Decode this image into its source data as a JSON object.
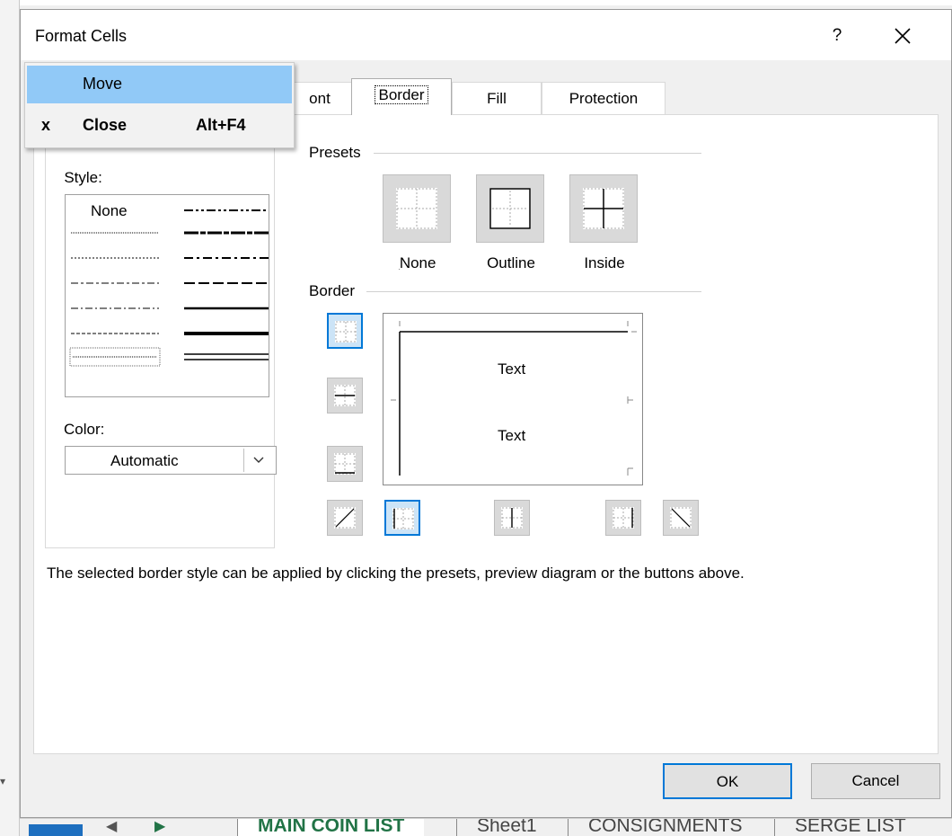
{
  "background": {
    "top_text": "",
    "sheet_tabs": [
      "MAIN COIN LIST",
      "Sheet1",
      "CONSIGNMENTS",
      "SERGE LIST"
    ]
  },
  "dialog": {
    "title": "Format Cells",
    "help": "?",
    "tabs": [
      "ont",
      "Border",
      "Fill",
      "Protection"
    ],
    "line": {
      "style_label": "Style:",
      "style_none": "None",
      "color_label": "Color:",
      "color_value": "Automatic"
    },
    "presets": {
      "label": "Presets",
      "items": [
        "None",
        "Outline",
        "Inside"
      ]
    },
    "border": {
      "label": "Border",
      "preview_text_1": "Text",
      "preview_text_2": "Text"
    },
    "description": "The selected border style can be applied by clicking the presets, preview diagram or the buttons above.",
    "ok_label": "OK",
    "cancel_label": "Cancel"
  },
  "system_menu": {
    "move_label": "Move",
    "close_marker": "x",
    "close_label": "Close",
    "close_shortcut": "Alt+F4"
  },
  "colors": {
    "accent": "#0078d7",
    "menu_highlight": "#91c9f7",
    "sheet_active": "#217346"
  }
}
